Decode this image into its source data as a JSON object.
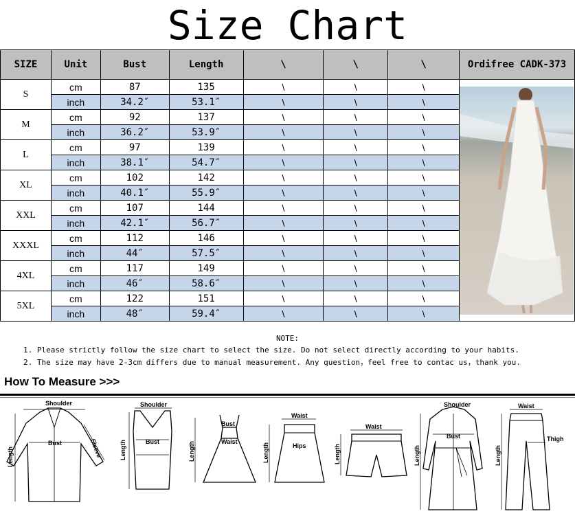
{
  "title": "Size Chart",
  "headers": [
    "SIZE",
    "Unit",
    "Bust",
    "Length",
    "\\",
    "\\",
    "\\"
  ],
  "model": "Ordifree CADK-373",
  "slash": "\\",
  "rows": [
    {
      "size": "S",
      "cm": [
        "cm",
        "87",
        "135"
      ],
      "inch": [
        "inch",
        "34.2″",
        "53.1″"
      ]
    },
    {
      "size": "M",
      "cm": [
        "cm",
        "92",
        "137"
      ],
      "inch": [
        "inch",
        "36.2″",
        "53.9″"
      ]
    },
    {
      "size": "L",
      "cm": [
        "cm",
        "97",
        "139"
      ],
      "inch": [
        "inch",
        "38.1″",
        "54.7″"
      ]
    },
    {
      "size": "XL",
      "cm": [
        "cm",
        "102",
        "142"
      ],
      "inch": [
        "inch",
        "40.1″",
        "55.9″"
      ]
    },
    {
      "size": "XXL",
      "cm": [
        "cm",
        "107",
        "144"
      ],
      "inch": [
        "inch",
        "42.1″",
        "56.7″"
      ]
    },
    {
      "size": "XXXL",
      "cm": [
        "cm",
        "112",
        "146"
      ],
      "inch": [
        "inch",
        "44″",
        "57.5″"
      ]
    },
    {
      "size": "4XL",
      "cm": [
        "cm",
        "117",
        "149"
      ],
      "inch": [
        "inch",
        "46″",
        "58.6″"
      ]
    },
    {
      "size": "5XL",
      "cm": [
        "cm",
        "122",
        "151"
      ],
      "inch": [
        "inch",
        "48″",
        "59.4″"
      ]
    }
  ],
  "note": {
    "heading": "NOTE:",
    "line1": "1. Please strictly follow the size chart  to select the size. Do not select directly according to your habits.",
    "line2": "2. The size may have 2-3cm differs due to manual measurement. Any question，feel free to contac us，thank you."
  },
  "how_to_measure": "How To Measure >>>",
  "figures": {
    "f1": {
      "shoulder": "Shoulder",
      "bust": "Bust",
      "length": "Length",
      "sleeve": "Sleeve"
    },
    "f2": {
      "shoulder": "Shoulder",
      "bust": "Bust",
      "length": "Length"
    },
    "f3": {
      "bust": "Bust",
      "waist": "Waist",
      "length": "Length"
    },
    "f4": {
      "waist": "Waist",
      "hips": "Hips",
      "length": "Length"
    },
    "f5": {
      "waist": "Waist",
      "length": "Length"
    },
    "f6": {
      "shoulder": "Shoulder",
      "bust": "Bust",
      "length": "Length"
    },
    "f7": {
      "waist": "Waist",
      "thigh": "Thigh",
      "length": "Length"
    }
  }
}
